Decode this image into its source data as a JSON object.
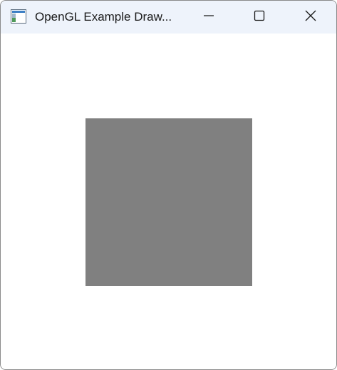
{
  "window": {
    "title": "OpenGL Example Draw...",
    "background_color": "#ffffff",
    "titlebar_color": "#eef3fb"
  },
  "titlebar": {
    "app_icon": "app-window-icon",
    "minimize_icon": "minimize-icon",
    "maximize_icon": "maximize-icon",
    "close_icon": "close-icon"
  },
  "scene": {
    "clear_color": "#ffffff",
    "shape": "square",
    "shape_color": "#808080"
  }
}
